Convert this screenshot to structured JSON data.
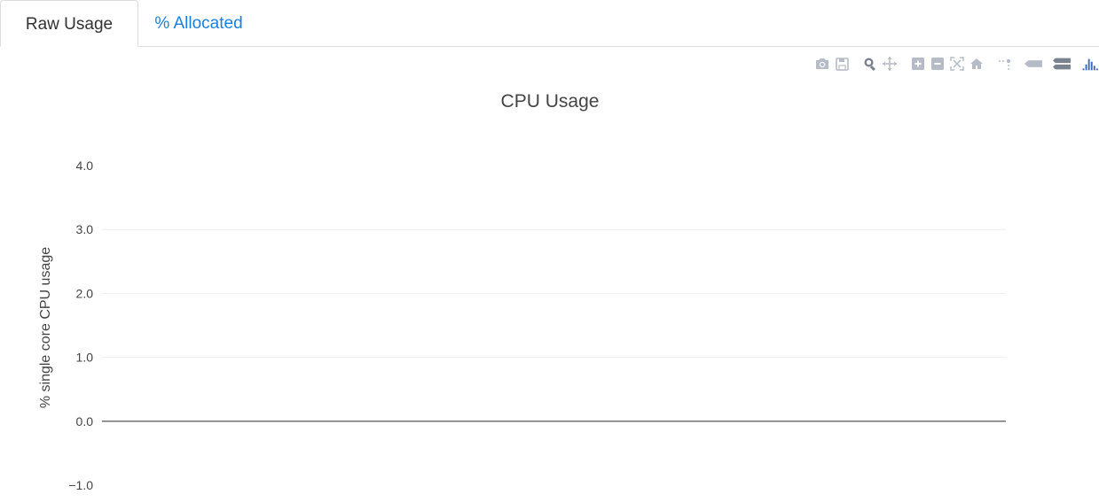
{
  "tabs": [
    {
      "label": "Raw Usage",
      "active": true
    },
    {
      "label": "% Allocated",
      "active": false
    }
  ],
  "modebar": {
    "icons": [
      "camera-icon",
      "save-icon",
      "zoom-icon",
      "pan-icon",
      "zoom-in-icon",
      "zoom-out-icon",
      "autoscale-icon",
      "reset-axes-icon",
      "spike-lines-icon",
      "hover-closest-icon",
      "hover-compare-icon",
      "plotly-logo-icon"
    ],
    "color": "#b6bcc7",
    "active_color": "#3f6bb8"
  },
  "chart_data": {
    "type": "line",
    "title": "CPU Usage",
    "xlabel": "",
    "ylabel": "% single core CPU usage",
    "ylim": [
      -1,
      4
    ],
    "yticks": [
      -1,
      0,
      1,
      2,
      3,
      4
    ],
    "ytick_labels": [
      "−1.0",
      "0.0",
      "1.0",
      "2.0",
      "3.0",
      "4.0"
    ],
    "grid": true,
    "zeroline": true,
    "series": []
  }
}
